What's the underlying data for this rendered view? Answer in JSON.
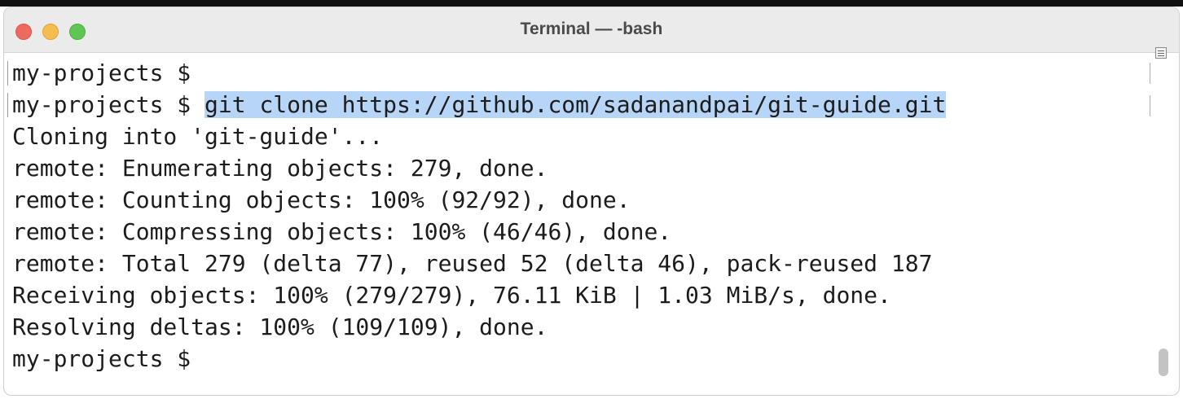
{
  "window": {
    "title": "Terminal — -bash",
    "controls": {
      "close_color": "#ee6a5f",
      "minimize_color": "#f5bd4f",
      "zoom_color": "#61c554"
    }
  },
  "terminal": {
    "prompt": "my-projects $ ",
    "command": "git clone https://github.com/sadanandpai/git-guide.git",
    "selection_color": "#b6d5f7",
    "output": [
      "Cloning into 'git-guide'...",
      "remote: Enumerating objects: 279, done.",
      "remote: Counting objects: 100% (92/92), done.",
      "remote: Compressing objects: 100% (46/46), done.",
      "remote: Total 279 (delta 77), reused 52 (delta 46), pack-reused 187",
      "Receiving objects: 100% (279/279), 76.11 KiB | 1.03 MiB/s, done.",
      "Resolving deltas: 100% (109/109), done."
    ],
    "final_prompt": "my-projects $"
  },
  "icons": {
    "marks": "marks-icon",
    "scrollbar": "scrollbar-thumb"
  }
}
